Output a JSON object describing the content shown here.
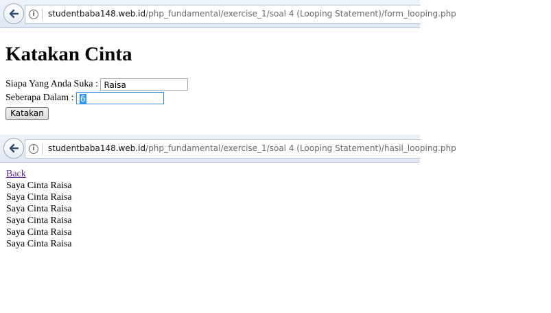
{
  "form_page": {
    "url_host": "studentbaba148.web.id",
    "url_path": "/php_fundamental/exercise_1/soal 4 (Looping Statement)/form_looping.php",
    "heading": "Katakan Cinta",
    "name_label": "Siapa Yang Anda Suka :",
    "name_value": "Raisa",
    "depth_label": "Seberapa Dalam :",
    "depth_value": "6",
    "submit_label": "Katakan"
  },
  "result_page": {
    "url_host": "studentbaba148.web.id",
    "url_path": "/php_fundamental/exercise_1/soal 4 (Looping Statement)/hasil_looping.php",
    "back_link": "Back",
    "lines": [
      "Saya Cinta Raisa",
      "Saya Cinta Raisa",
      "Saya Cinta Raisa",
      "Saya Cinta Raisa",
      "Saya Cinta Raisa",
      "Saya Cinta Raisa"
    ]
  },
  "icons": {
    "back": "back-arrow-icon",
    "info": "info-icon"
  }
}
